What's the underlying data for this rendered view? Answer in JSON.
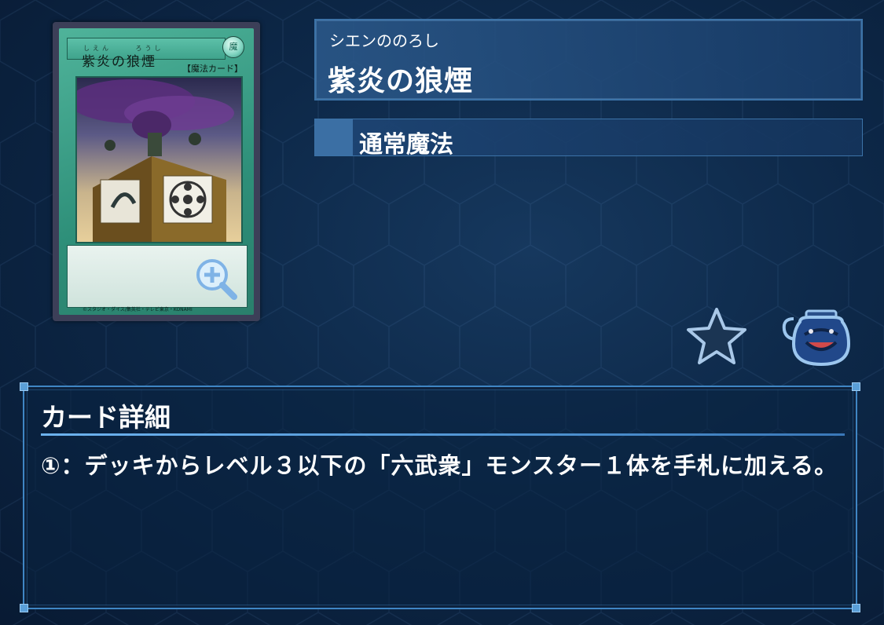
{
  "card_image": {
    "ruby": "しえん　　 ろうし",
    "name": "紫炎の狼煙",
    "attribute_label": "魔",
    "type_label": "【魔法カード】",
    "copyright": "©スタジオ・ダイス/集英社・テレビ東京・KONAMI"
  },
  "card_header": {
    "reading": "シエンののろし",
    "name": "紫炎の狼煙",
    "spell_type": "通常魔法"
  },
  "icons": {
    "favorite": "star-icon",
    "pot": "pot-of-greed-icon",
    "zoom": "zoom-in-icon"
  },
  "details": {
    "title": "カード詳細",
    "effect": "①：デッキからレベル３以下の「六武衆」モンスター１体を手札に加える。"
  },
  "colors": {
    "accent": "#3f86c4",
    "card_frame": "#2e8f79",
    "background": "#0d2848"
  }
}
